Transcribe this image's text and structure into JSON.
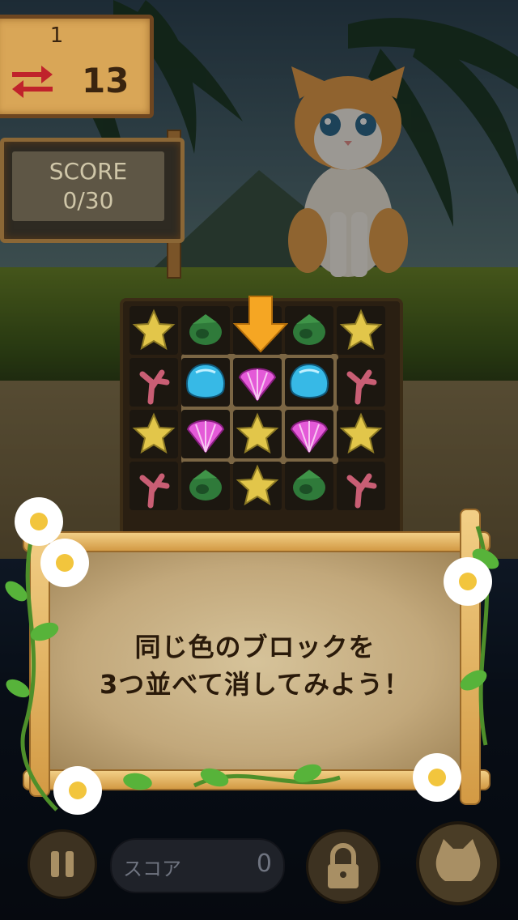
{
  "hud": {
    "level": "1",
    "moves": "13",
    "score_label": "SCORE",
    "score_value": "0/30"
  },
  "board": {
    "rows": [
      [
        "star",
        "conch",
        "empty",
        "conch",
        "star"
      ],
      [
        "coral",
        "blue-shell",
        "pink-shell",
        "blue-shell",
        "coral"
      ],
      [
        "star",
        "pink-shell",
        "star",
        "pink-shell",
        "star"
      ],
      [
        "coral",
        "conch",
        "star",
        "conch",
        "coral"
      ]
    ],
    "hint": "arrow-down"
  },
  "tutorial": {
    "line1": "同じ色のブロックを",
    "line2": "3つ並べて消してみよう！"
  },
  "bottom_bar": {
    "score_label": "スコア",
    "score_value": "0",
    "pause_icon": "pause-icon",
    "lock_icon": "lock-icon",
    "cat_icon": "cat-icon"
  },
  "colors": {
    "arrow": "#f5a623",
    "blue_shell": "#37b9e6",
    "pink_shell": "#e45ad8",
    "star": "#e2c64a"
  }
}
